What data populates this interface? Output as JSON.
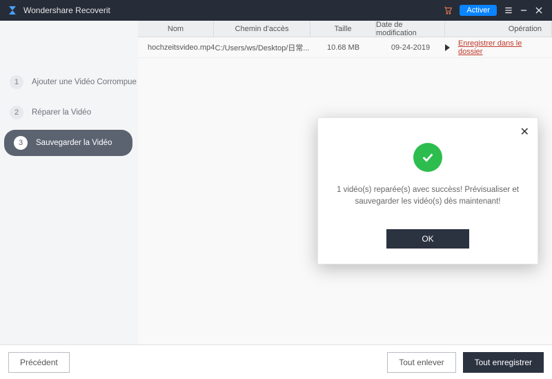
{
  "titlebar": {
    "title": "Wondershare Recoverit",
    "activer": "Activer"
  },
  "sidebar": {
    "steps": [
      {
        "num": "1",
        "label": "Ajouter une Vidéo Corrompue"
      },
      {
        "num": "2",
        "label": "Réparer la Vidéo"
      },
      {
        "num": "3",
        "label": "Sauvegarder la Vidéo"
      }
    ]
  },
  "table": {
    "headers": {
      "name": "Nom",
      "path": "Chemin d'accès",
      "size": "Taille",
      "date": "Date de modification",
      "op": "Opération"
    },
    "rows": [
      {
        "name": "hochzeitsvideo.mp4",
        "path": "C:/Users/ws/Desktop/日常...",
        "size": "10.68 MB",
        "date": "09-24-2019",
        "op": "Enregistrer dans le dossier"
      }
    ]
  },
  "footer": {
    "prev": "Précédent",
    "remove_all": "Tout enlever",
    "save_all": "Tout enregistrer"
  },
  "modal": {
    "message": "1 vidéo(s) reparée(s) avec succèss! Prévisualiser et sauvegarder les vidéo(s) dès maintenant!",
    "ok": "OK"
  },
  "icons": {
    "cart": "cart-icon",
    "menu": "menu-icon",
    "minimize": "minimize-icon",
    "close": "close-icon",
    "logo": "logo-icon"
  }
}
